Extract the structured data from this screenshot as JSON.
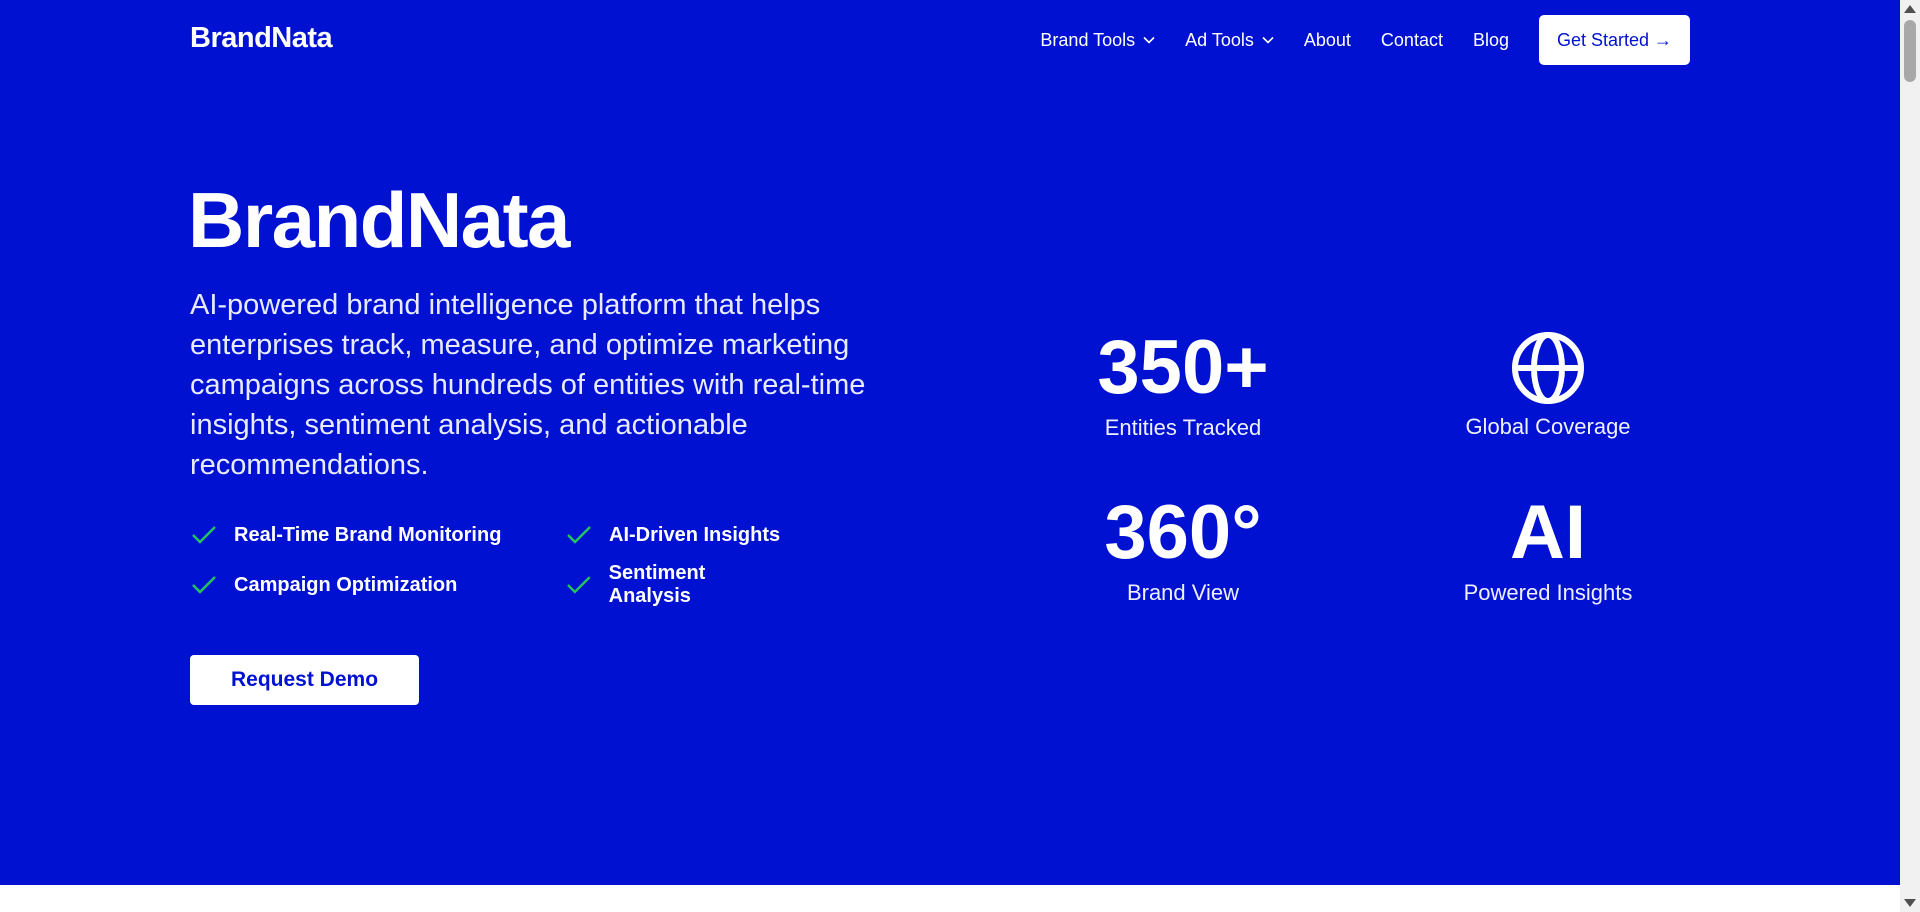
{
  "nav": {
    "logo": "BrandNata",
    "links": [
      {
        "label": "Brand Tools",
        "dropdown": true
      },
      {
        "label": "Ad Tools",
        "dropdown": true
      },
      {
        "label": "About"
      },
      {
        "label": "Contact"
      },
      {
        "label": "Blog"
      }
    ],
    "cta": "Get Started →"
  },
  "hero": {
    "title": "BrandNata",
    "description": "AI-powered brand intelligence platform that helps enterprises track, measure, and optimize marketing campaigns across hundreds of entities with real-time insights, sentiment analysis, and actionable recommendations.",
    "features": [
      "Real-Time Brand Monitoring",
      "AI-Driven Insights",
      "Campaign Optimization",
      "Sentiment Analysis"
    ],
    "demo_button": "Request Demo"
  },
  "stats": [
    {
      "value": "350+",
      "label": "Entities Tracked"
    },
    {
      "icon": "globe-icon",
      "label": "Global Coverage"
    },
    {
      "value": "360°",
      "label": "Brand View"
    },
    {
      "value": "AI",
      "label": "Powered Insights"
    }
  ],
  "colors": {
    "hero_bg": "#0011d1",
    "check": "#22c55e",
    "text": "#ffffff"
  }
}
